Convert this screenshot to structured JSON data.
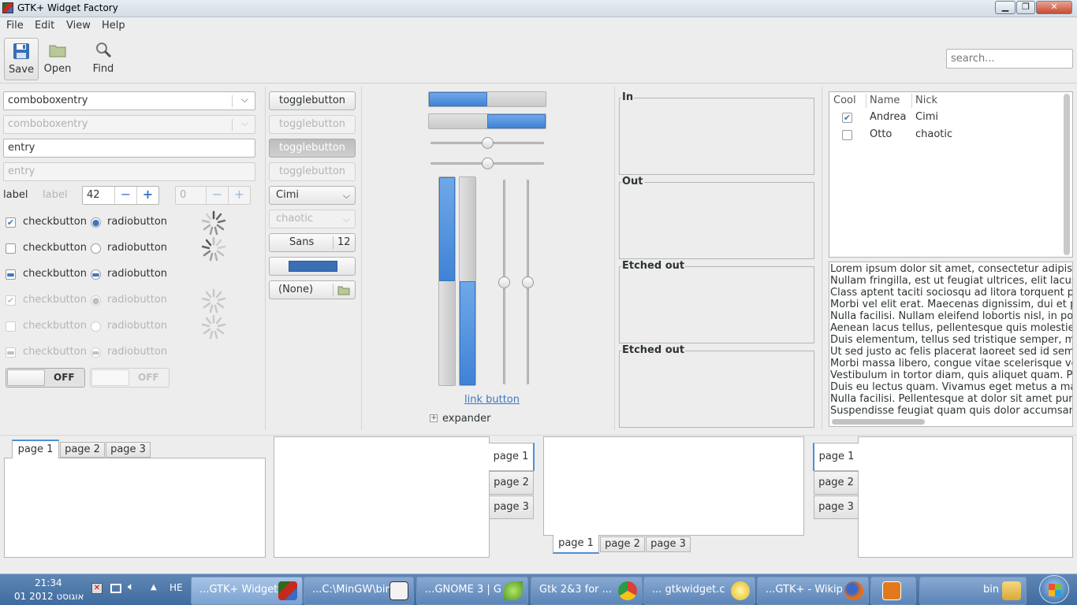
{
  "window": {
    "title": "GTK+ Widget Factory",
    "controls": [
      "▁",
      "❐",
      "✕"
    ]
  },
  "menubar": {
    "items": [
      "File",
      "Edit",
      "View",
      "Help"
    ]
  },
  "toolbar": {
    "save": "Save",
    "open": "Open",
    "find": "Find",
    "search_placeholder": "search..."
  },
  "col1": {
    "combo1": "comboboxentry",
    "combo2": "comboboxentry",
    "entry1": "entry",
    "entry2": "entry",
    "label1": "label",
    "label2": "label",
    "spin1": "42",
    "spin2": "0",
    "check": "checkbutton",
    "radio": "radiobutton",
    "switch_off": "OFF"
  },
  "col2": {
    "toggle": "togglebutton",
    "combo_cimi": "Cimi",
    "combo_chaotic": "chaotic",
    "font_name": "Sans",
    "font_size": "12",
    "file_none": "(None)"
  },
  "col3": {
    "link": "link button",
    "expander": "expander",
    "progress1": 0.5,
    "progress2": 0.5
  },
  "frames": {
    "in": "In",
    "out": "Out",
    "etched1": "Etched out",
    "etched2": "Etched out"
  },
  "tree": {
    "headers": [
      "Cool",
      "Name",
      "Nick"
    ],
    "rows": [
      {
        "cool": true,
        "name": "Andrea",
        "nick": "Cimi"
      },
      {
        "cool": false,
        "name": "Otto",
        "nick": "chaotic"
      }
    ]
  },
  "text": [
    "Lorem ipsum dolor sit amet, consectetur adipiscing",
    "Nullam fringilla, est ut feugiat ultrices, elit lacus ",
    "Class aptent taciti sociosqu ad litora torquent per",
    "Morbi vel elit erat. Maecenas dignissim, dui et ph",
    "Nulla facilisi. Nullam eleifend lobortis nisl, in port",
    "Aenean lacus tellus, pellentesque quis molestie",
    "Duis elementum, tellus sed tristique semper, me",
    "Ut sed justo ac felis placerat laoreet sed id sem.",
    "Morbi massa libero, congue vitae scelerisque ve",
    "Vestibulum in tortor diam, quis aliquet quam. Pr",
    "Duis eu lectus quam. Vivamus eget metus a ma",
    "Nulla facilisi. Pellentesque at dolor sit amet puru",
    "Suspendisse feugiat quam quis dolor accumsan"
  ],
  "tabs": {
    "p1": "page 1",
    "p2": "page 2",
    "p3": "page 3"
  },
  "taskbar": {
    "time": "21:34",
    "date": "01 אוגוסט 2012",
    "lang": "HE",
    "items": [
      "...GTK+ Widget",
      "...C:\\MinGW\\bin",
      "...GNOME 3 | G",
      "Gtk 2&3 for ...",
      "... gtkwidget.c",
      "...GTK+ - Wikip",
      "bin"
    ]
  },
  "colors": {
    "accent": "#3f83d6",
    "taskbar": "#5b84b8"
  }
}
